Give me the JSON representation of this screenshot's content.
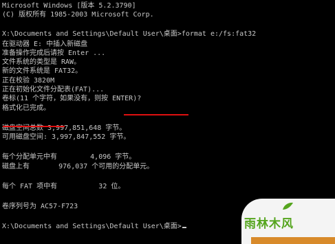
{
  "console": {
    "lines": [
      "Microsoft Windows [版本 5.2.3790]",
      "(C) 版权所有 1985-2003 Microsoft Corp.",
      "",
      "X:\\Documents and Settings\\Default User\\桌面>format e:/fs:fat32",
      "在驱动器 E: 中插入新磁盘",
      "准备操作完成后请按 Enter ...",
      "文件系统的类型是 RAW。",
      "新的文件系统是 FAT32。",
      "正在校验 3820M",
      "正在初始化文件分配表(FAT)...",
      "卷标(11 个字符，如果没有，则按 ENTER)?",
      "格式化已完成。",
      "",
      "磁盘空间总数 3,997,851,648 字节。",
      "可用磁盘空间: 3,997,847,552 字节。",
      "",
      "每个分配单元中有        4,096 字节。",
      "磁盘上有       976,037 个可用的分配单元。",
      "",
      "每个 FAT 项中有          32 位。",
      "",
      "卷序列号为 AC57-F723",
      "",
      "X:\\Documents and Settings\\Default User\\桌面>"
    ]
  },
  "watermark": {
    "text": "雨林木风"
  },
  "colors": {
    "background": "#000000",
    "text": "#c8c8c8",
    "highlight_underline": "#e01010",
    "watermark_text": "#55a51e",
    "watermark_bar": "#d88a2a"
  }
}
